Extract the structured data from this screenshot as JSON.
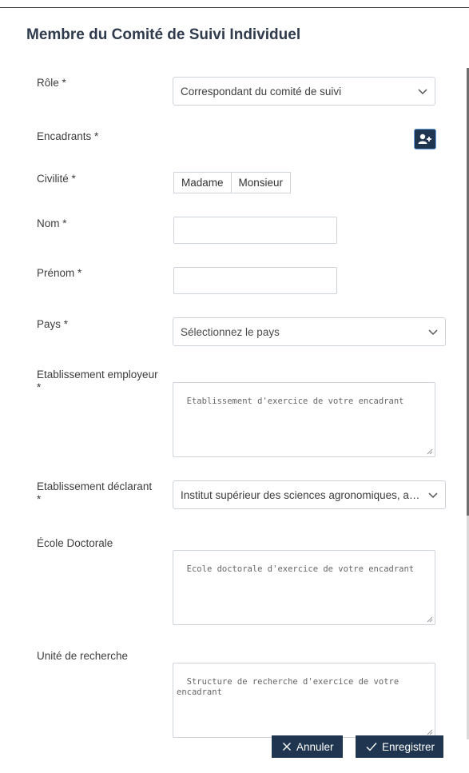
{
  "dialog": {
    "title": "Membre du Comité de Suivi Individuel"
  },
  "form": {
    "role": {
      "label": "Rôle *",
      "value": "Correspondant du comité de suivi"
    },
    "encadrants": {
      "label": "Encadrants *"
    },
    "civilite": {
      "label": "Civilité *",
      "options": [
        "Madame",
        "Monsieur"
      ]
    },
    "nom": {
      "label": "Nom *",
      "value": ""
    },
    "prenom": {
      "label": "Prénom *",
      "value": ""
    },
    "pays": {
      "label": "Pays *",
      "placeholder": "Sélectionnez le pays"
    },
    "etablissement_employeur": {
      "label": "Etablissement employeur",
      "label_req": "*",
      "placeholder": "Etablissement d'exercice de votre encadrant"
    },
    "etablissement_declarant": {
      "label": "Etablissement déclarant",
      "label_req": "*",
      "value": "Institut supérieur des sciences agronomiques, agroalimentaires, horticoles et du paysage"
    },
    "ecole_doctorale": {
      "label": "École Doctorale",
      "placeholder": "Ecole doctorale d'exercice de votre encadrant"
    },
    "unite_recherche": {
      "label": "Unité de recherche",
      "placeholder": "Structure de recherche d'exercice de votre encadrant"
    }
  },
  "actions": {
    "cancel_label": "Annuler",
    "save_label": "Enregistrer"
  },
  "icons": {
    "chevron": "chevron-down-icon",
    "add_person": "user-plus-icon",
    "cancel": "close-icon",
    "save": "check-icon",
    "resize": "resize-handle-icon"
  },
  "colors": {
    "title": "#2f3b4c",
    "primary_button": "#1f3550",
    "border": "#cfd4da"
  }
}
